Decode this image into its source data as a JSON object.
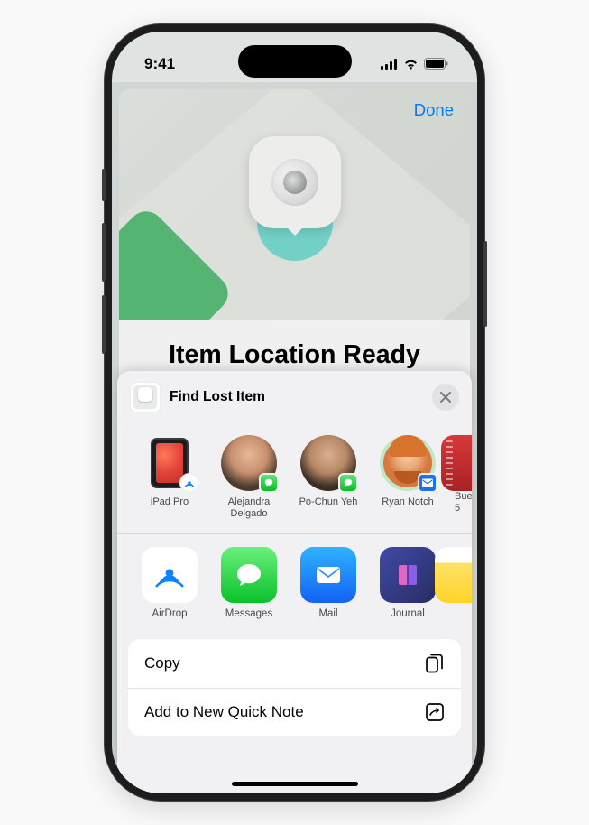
{
  "status": {
    "time": "9:41"
  },
  "modal": {
    "done_label": "Done",
    "title": "Item Location Ready"
  },
  "share_sheet": {
    "title": "Find Lost Item",
    "contacts": [
      {
        "name": "iPad Pro"
      },
      {
        "name": "Alejandra Delgado"
      },
      {
        "name": "Po-Chun Yeh"
      },
      {
        "name": "Ryan Notch"
      },
      {
        "name_partial": "Buen",
        "sub_partial": "5"
      }
    ],
    "apps": [
      {
        "name": "AirDrop"
      },
      {
        "name": "Messages"
      },
      {
        "name": "Mail"
      },
      {
        "name": "Journal"
      },
      {
        "name": ""
      }
    ],
    "actions": {
      "copy": "Copy",
      "quick_note": "Add to New Quick Note"
    }
  }
}
